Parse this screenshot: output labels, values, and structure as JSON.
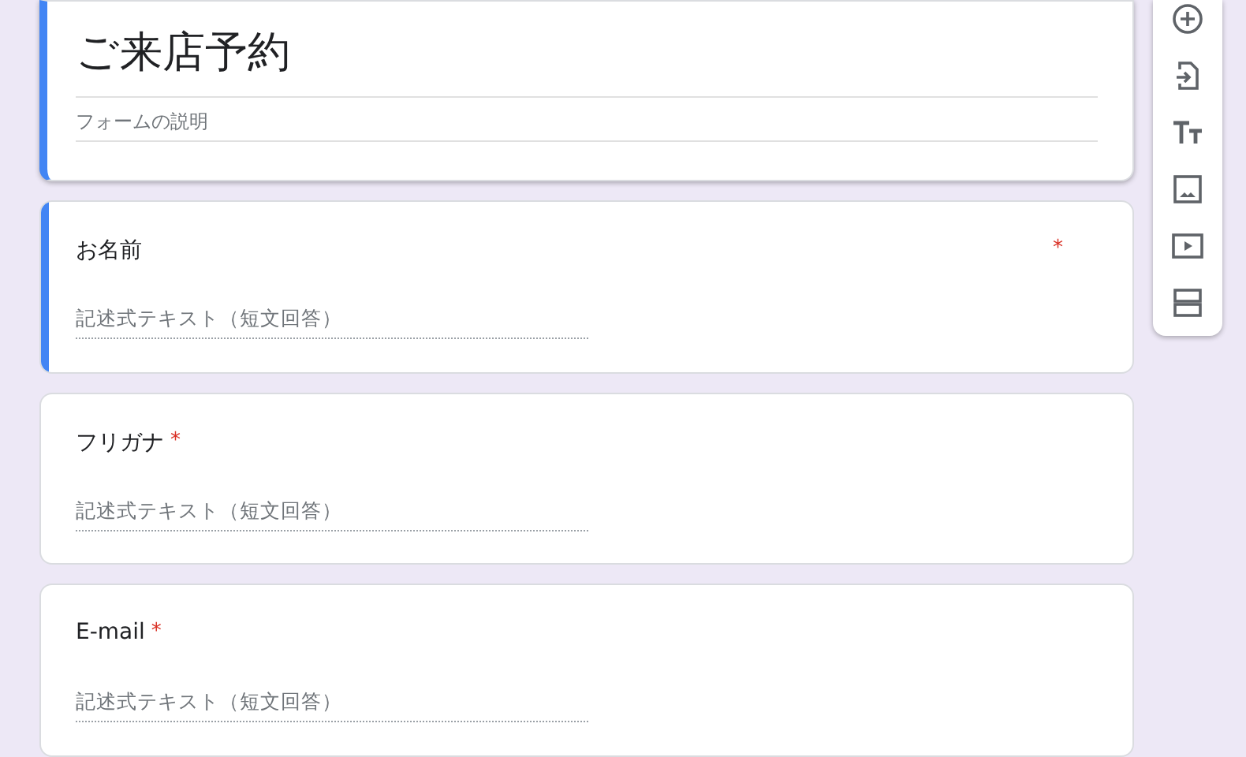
{
  "form": {
    "title": "ご来店予約",
    "description_placeholder": "フォームの説明"
  },
  "questions": [
    {
      "label": "お名前",
      "required_mark": "*",
      "selected": true,
      "answer_placeholder": "記述式テキスト（短文回答）"
    },
    {
      "label": "フリガナ",
      "required_mark": "*",
      "selected": false,
      "answer_placeholder": "記述式テキスト（短文回答）"
    },
    {
      "label": "E-mail",
      "required_mark": "*",
      "selected": false,
      "answer_placeholder": "記述式テキスト（短文回答）"
    }
  ]
}
